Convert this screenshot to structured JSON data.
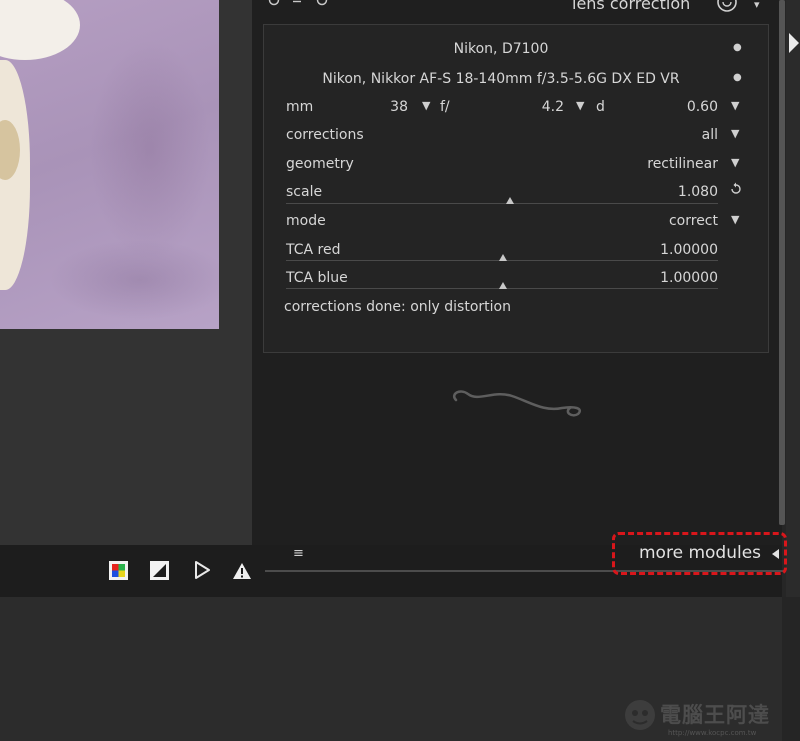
{
  "module": {
    "title": "lens correction",
    "camera": "Nikon, D7100",
    "lens": "Nikon, Nikkor AF-S 18-140mm f/3.5-5.6G DX ED VR",
    "focal": {
      "label": "mm",
      "value": "38"
    },
    "aperture": {
      "label": "f/",
      "value": "4.2"
    },
    "distance": {
      "label": "d",
      "value": "0.60"
    },
    "corrections": {
      "label": "corrections",
      "value": "all"
    },
    "geometry": {
      "label": "geometry",
      "value": "rectilinear"
    },
    "scale": {
      "label": "scale",
      "value": "1.080",
      "position": 0.5
    },
    "mode": {
      "label": "mode",
      "value": "correct"
    },
    "tca_red": {
      "label": "TCA red",
      "value": "1.00000",
      "position": 0.5
    },
    "tca_blue": {
      "label": "TCA blue",
      "value": "1.00000",
      "position": 0.5
    },
    "status": "corrections done: only distortion"
  },
  "footer": {
    "more_modules": "more modules",
    "menu_glyph": "≡"
  },
  "header_icons": [
    "reset-icon",
    "presets-icon",
    "power-icon"
  ],
  "watermark": {
    "text": "電腦王阿達",
    "url": "http://www.kocpc.com.tw"
  },
  "colors": {
    "highlight": "#d8161b",
    "panel": "#1f1f1f",
    "module_bg": "#242424"
  }
}
